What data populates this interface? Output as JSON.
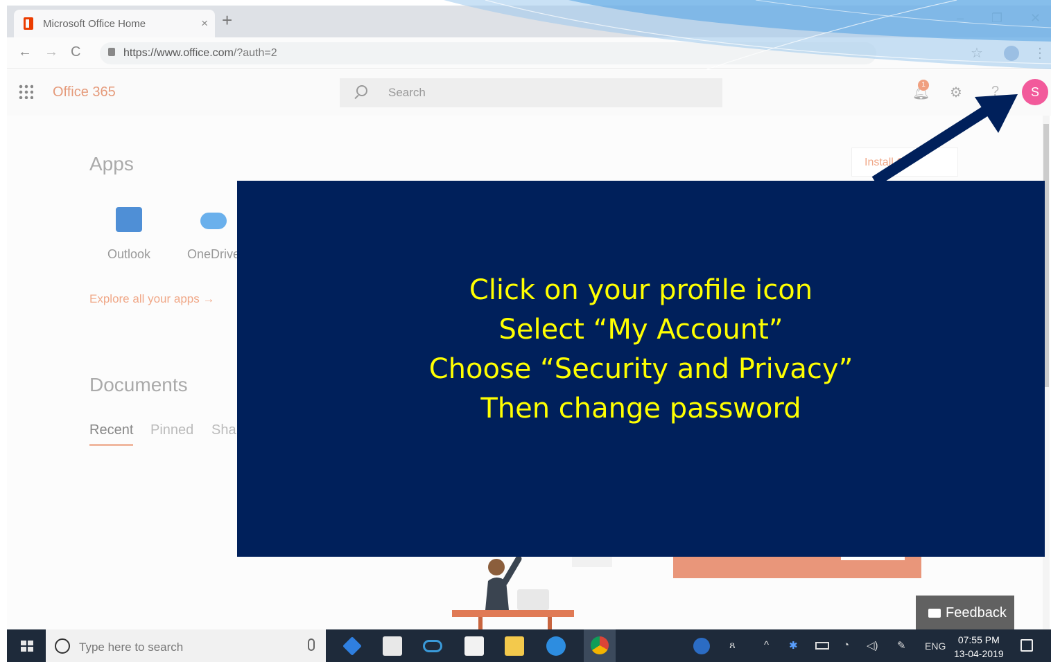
{
  "browser": {
    "tab_title": "Microsoft Office Home",
    "tab_close": "×",
    "new_tab": "+",
    "url_host": "https://www.office.com",
    "url_path": "/?auth=2",
    "controls": {
      "minimize": "–",
      "restore": "❐",
      "close": "✕"
    },
    "nav": {
      "back": "←",
      "forward": "→",
      "reload": "C"
    },
    "bookmark": "☆",
    "menu": "⋮"
  },
  "office_header": {
    "brand": "Office 365",
    "search_placeholder": "Search",
    "notification_count": "1",
    "help": "?",
    "avatar_initial": "S",
    "avatar_color": "#f25a9b"
  },
  "main": {
    "apps_heading": "Apps",
    "apps": [
      {
        "label": "Outlook",
        "icon": "outlook-icon"
      },
      {
        "label": "OneDrive",
        "icon": "onedrive-icon"
      }
    ],
    "explore_link": "Explore all your apps",
    "explore_arrow": "→",
    "install_button": "Install O",
    "documents_heading": "Documents",
    "doc_tabs": [
      "Recent",
      "Pinned",
      "Shar"
    ],
    "feedback_button": "Feedback"
  },
  "overlay": {
    "background": "#00205b",
    "text_color": "#ffff00",
    "lines": [
      "Click on your profile icon",
      "Select “My Account”",
      "Choose “Security and Privacy”",
      "Then change password"
    ]
  },
  "taskbar": {
    "search_placeholder": "Type here to search",
    "language": "ENG",
    "time": "07:55 PM",
    "date": "13-04-2019"
  }
}
